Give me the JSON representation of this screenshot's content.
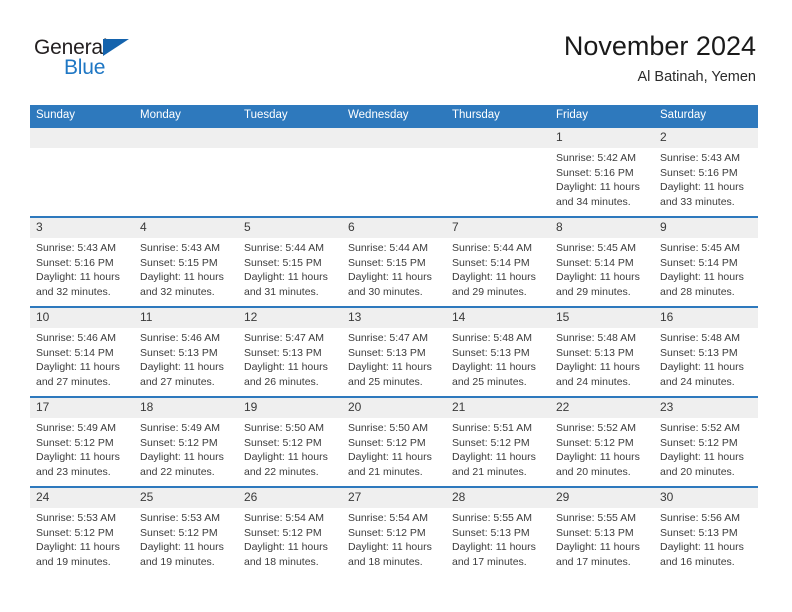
{
  "brand": {
    "name_part1": "General",
    "name_part2": "Blue",
    "triangle_icon": "flag-triangle-icon",
    "accent_color": "#1463ad",
    "blue_text_color": "#1f77c4"
  },
  "header": {
    "title": "November 2024",
    "subtitle": "Al Batinah, Yemen"
  },
  "theme": {
    "header_bar_color": "#2e79bd",
    "daynum_band_color": "#efefef",
    "cell_bg_color": "#ffffff",
    "text_color": "#3c3c3c"
  },
  "weekdays": [
    "Sunday",
    "Monday",
    "Tuesday",
    "Wednesday",
    "Thursday",
    "Friday",
    "Saturday"
  ],
  "weeks": [
    [
      {
        "day": "",
        "sunrise": "",
        "sunset": "",
        "daylight_line1": "",
        "daylight_line2": ""
      },
      {
        "day": "",
        "sunrise": "",
        "sunset": "",
        "daylight_line1": "",
        "daylight_line2": ""
      },
      {
        "day": "",
        "sunrise": "",
        "sunset": "",
        "daylight_line1": "",
        "daylight_line2": ""
      },
      {
        "day": "",
        "sunrise": "",
        "sunset": "",
        "daylight_line1": "",
        "daylight_line2": ""
      },
      {
        "day": "",
        "sunrise": "",
        "sunset": "",
        "daylight_line1": "",
        "daylight_line2": ""
      },
      {
        "day": "1",
        "sunrise": "Sunrise: 5:42 AM",
        "sunset": "Sunset: 5:16 PM",
        "daylight_line1": "Daylight: 11 hours",
        "daylight_line2": "and 34 minutes."
      },
      {
        "day": "2",
        "sunrise": "Sunrise: 5:43 AM",
        "sunset": "Sunset: 5:16 PM",
        "daylight_line1": "Daylight: 11 hours",
        "daylight_line2": "and 33 minutes."
      }
    ],
    [
      {
        "day": "3",
        "sunrise": "Sunrise: 5:43 AM",
        "sunset": "Sunset: 5:16 PM",
        "daylight_line1": "Daylight: 11 hours",
        "daylight_line2": "and 32 minutes."
      },
      {
        "day": "4",
        "sunrise": "Sunrise: 5:43 AM",
        "sunset": "Sunset: 5:15 PM",
        "daylight_line1": "Daylight: 11 hours",
        "daylight_line2": "and 32 minutes."
      },
      {
        "day": "5",
        "sunrise": "Sunrise: 5:44 AM",
        "sunset": "Sunset: 5:15 PM",
        "daylight_line1": "Daylight: 11 hours",
        "daylight_line2": "and 31 minutes."
      },
      {
        "day": "6",
        "sunrise": "Sunrise: 5:44 AM",
        "sunset": "Sunset: 5:15 PM",
        "daylight_line1": "Daylight: 11 hours",
        "daylight_line2": "and 30 minutes."
      },
      {
        "day": "7",
        "sunrise": "Sunrise: 5:44 AM",
        "sunset": "Sunset: 5:14 PM",
        "daylight_line1": "Daylight: 11 hours",
        "daylight_line2": "and 29 minutes."
      },
      {
        "day": "8",
        "sunrise": "Sunrise: 5:45 AM",
        "sunset": "Sunset: 5:14 PM",
        "daylight_line1": "Daylight: 11 hours",
        "daylight_line2": "and 29 minutes."
      },
      {
        "day": "9",
        "sunrise": "Sunrise: 5:45 AM",
        "sunset": "Sunset: 5:14 PM",
        "daylight_line1": "Daylight: 11 hours",
        "daylight_line2": "and 28 minutes."
      }
    ],
    [
      {
        "day": "10",
        "sunrise": "Sunrise: 5:46 AM",
        "sunset": "Sunset: 5:14 PM",
        "daylight_line1": "Daylight: 11 hours",
        "daylight_line2": "and 27 minutes."
      },
      {
        "day": "11",
        "sunrise": "Sunrise: 5:46 AM",
        "sunset": "Sunset: 5:13 PM",
        "daylight_line1": "Daylight: 11 hours",
        "daylight_line2": "and 27 minutes."
      },
      {
        "day": "12",
        "sunrise": "Sunrise: 5:47 AM",
        "sunset": "Sunset: 5:13 PM",
        "daylight_line1": "Daylight: 11 hours",
        "daylight_line2": "and 26 minutes."
      },
      {
        "day": "13",
        "sunrise": "Sunrise: 5:47 AM",
        "sunset": "Sunset: 5:13 PM",
        "daylight_line1": "Daylight: 11 hours",
        "daylight_line2": "and 25 minutes."
      },
      {
        "day": "14",
        "sunrise": "Sunrise: 5:48 AM",
        "sunset": "Sunset: 5:13 PM",
        "daylight_line1": "Daylight: 11 hours",
        "daylight_line2": "and 25 minutes."
      },
      {
        "day": "15",
        "sunrise": "Sunrise: 5:48 AM",
        "sunset": "Sunset: 5:13 PM",
        "daylight_line1": "Daylight: 11 hours",
        "daylight_line2": "and 24 minutes."
      },
      {
        "day": "16",
        "sunrise": "Sunrise: 5:48 AM",
        "sunset": "Sunset: 5:13 PM",
        "daylight_line1": "Daylight: 11 hours",
        "daylight_line2": "and 24 minutes."
      }
    ],
    [
      {
        "day": "17",
        "sunrise": "Sunrise: 5:49 AM",
        "sunset": "Sunset: 5:12 PM",
        "daylight_line1": "Daylight: 11 hours",
        "daylight_line2": "and 23 minutes."
      },
      {
        "day": "18",
        "sunrise": "Sunrise: 5:49 AM",
        "sunset": "Sunset: 5:12 PM",
        "daylight_line1": "Daylight: 11 hours",
        "daylight_line2": "and 22 minutes."
      },
      {
        "day": "19",
        "sunrise": "Sunrise: 5:50 AM",
        "sunset": "Sunset: 5:12 PM",
        "daylight_line1": "Daylight: 11 hours",
        "daylight_line2": "and 22 minutes."
      },
      {
        "day": "20",
        "sunrise": "Sunrise: 5:50 AM",
        "sunset": "Sunset: 5:12 PM",
        "daylight_line1": "Daylight: 11 hours",
        "daylight_line2": "and 21 minutes."
      },
      {
        "day": "21",
        "sunrise": "Sunrise: 5:51 AM",
        "sunset": "Sunset: 5:12 PM",
        "daylight_line1": "Daylight: 11 hours",
        "daylight_line2": "and 21 minutes."
      },
      {
        "day": "22",
        "sunrise": "Sunrise: 5:52 AM",
        "sunset": "Sunset: 5:12 PM",
        "daylight_line1": "Daylight: 11 hours",
        "daylight_line2": "and 20 minutes."
      },
      {
        "day": "23",
        "sunrise": "Sunrise: 5:52 AM",
        "sunset": "Sunset: 5:12 PM",
        "daylight_line1": "Daylight: 11 hours",
        "daylight_line2": "and 20 minutes."
      }
    ],
    [
      {
        "day": "24",
        "sunrise": "Sunrise: 5:53 AM",
        "sunset": "Sunset: 5:12 PM",
        "daylight_line1": "Daylight: 11 hours",
        "daylight_line2": "and 19 minutes."
      },
      {
        "day": "25",
        "sunrise": "Sunrise: 5:53 AM",
        "sunset": "Sunset: 5:12 PM",
        "daylight_line1": "Daylight: 11 hours",
        "daylight_line2": "and 19 minutes."
      },
      {
        "day": "26",
        "sunrise": "Sunrise: 5:54 AM",
        "sunset": "Sunset: 5:12 PM",
        "daylight_line1": "Daylight: 11 hours",
        "daylight_line2": "and 18 minutes."
      },
      {
        "day": "27",
        "sunrise": "Sunrise: 5:54 AM",
        "sunset": "Sunset: 5:12 PM",
        "daylight_line1": "Daylight: 11 hours",
        "daylight_line2": "and 18 minutes."
      },
      {
        "day": "28",
        "sunrise": "Sunrise: 5:55 AM",
        "sunset": "Sunset: 5:13 PM",
        "daylight_line1": "Daylight: 11 hours",
        "daylight_line2": "and 17 minutes."
      },
      {
        "day": "29",
        "sunrise": "Sunrise: 5:55 AM",
        "sunset": "Sunset: 5:13 PM",
        "daylight_line1": "Daylight: 11 hours",
        "daylight_line2": "and 17 minutes."
      },
      {
        "day": "30",
        "sunrise": "Sunrise: 5:56 AM",
        "sunset": "Sunset: 5:13 PM",
        "daylight_line1": "Daylight: 11 hours",
        "daylight_line2": "and 16 minutes."
      }
    ]
  ]
}
